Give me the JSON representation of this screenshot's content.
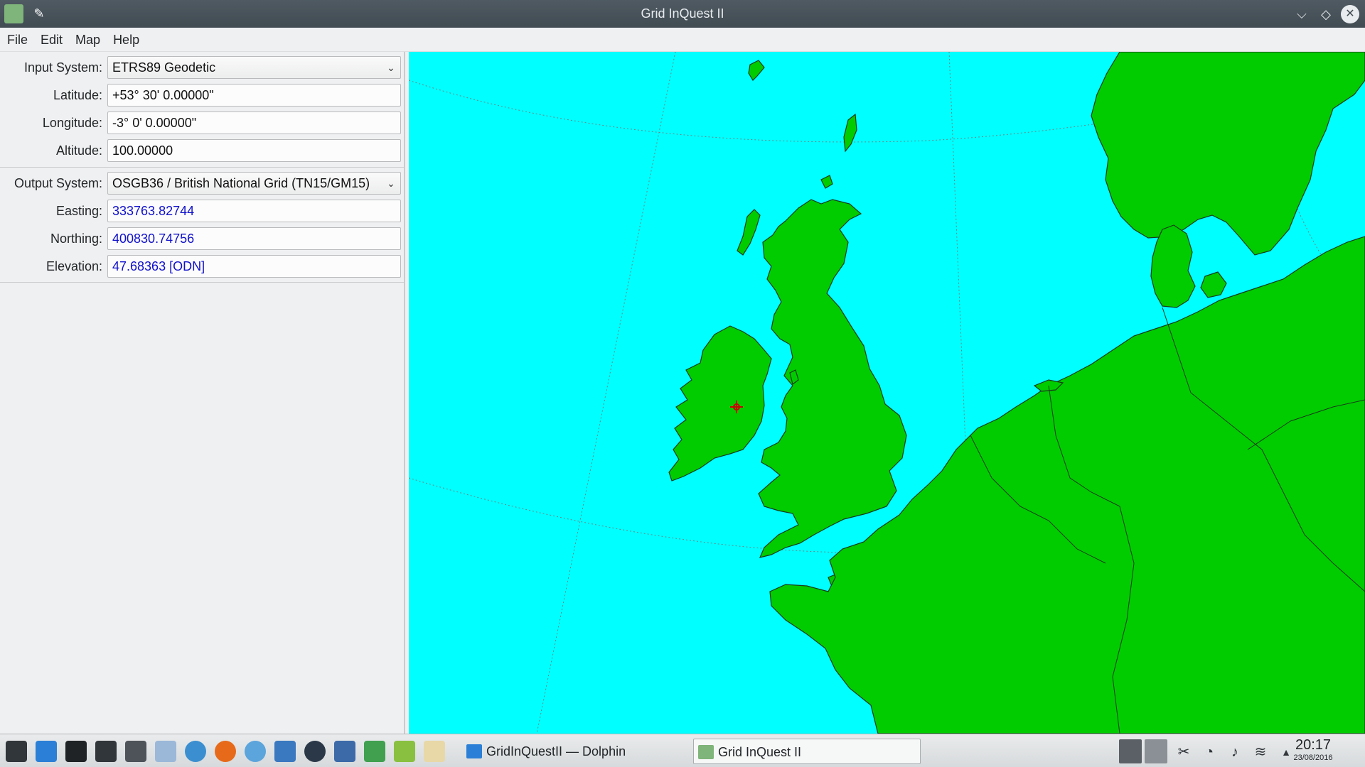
{
  "window": {
    "title": "Grid InQuest II",
    "buttons": {
      "minimize": "⌵",
      "maximize": "◇",
      "close": "✕"
    },
    "pin_icon": "pin-icon"
  },
  "menu": [
    "File",
    "Edit",
    "Map",
    "Help"
  ],
  "input": {
    "system_label": "Input System:",
    "system_value": "ETRS89 Geodetic",
    "latitude_label": "Latitude:",
    "latitude_value": "+53° 30' 0.00000\"",
    "longitude_label": "Longitude:",
    "longitude_value": "-3° 0' 0.00000\"",
    "altitude_label": "Altitude:",
    "altitude_value": "100.00000"
  },
  "output": {
    "system_label": "Output System:",
    "system_value": "OSGB36 / British National Grid (TN15/GM15)",
    "easting_label": "Easting:",
    "easting_value": "333763.82744",
    "northing_label": "Northing:",
    "northing_value": "400830.74756",
    "elevation_label": "Elevation:",
    "elevation_value": "47.68363 [ODN]"
  },
  "colors": {
    "sea": "#00ffff",
    "land": "#00cc00",
    "output_text": "#1010cc",
    "marker": "#cc0000"
  },
  "taskbar": {
    "tasks": [
      {
        "label": "GridInQuestII — Dolphin"
      },
      {
        "label": "Grid InQuest II"
      }
    ],
    "clock_time": "20:17",
    "clock_date": "23/08/2016"
  }
}
